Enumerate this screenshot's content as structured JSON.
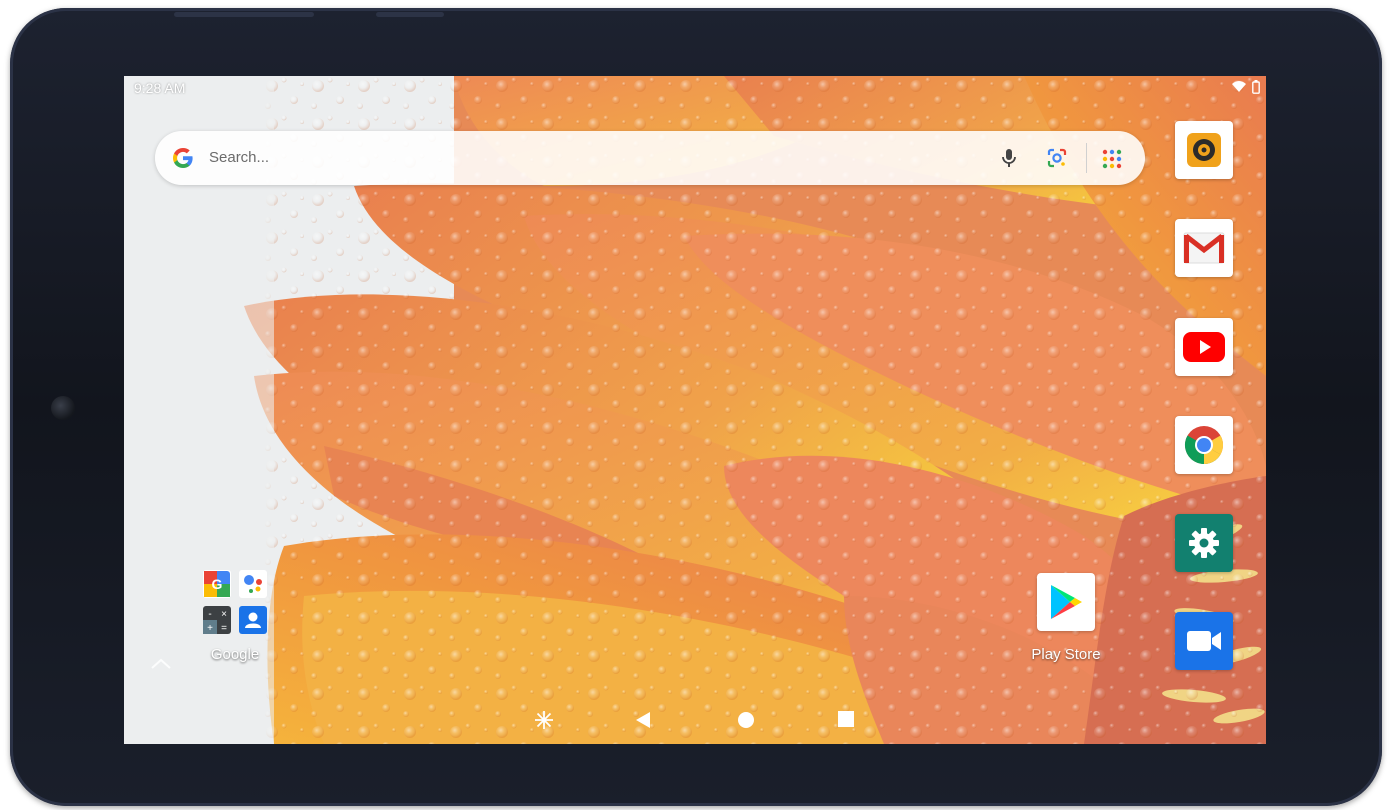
{
  "status_bar": {
    "time": "9:28 AM",
    "icons": [
      "wifi-icon",
      "battery-icon"
    ]
  },
  "search": {
    "placeholder": "Search...",
    "icons": [
      "google-g-icon",
      "microphone-icon",
      "google-lens-icon",
      "app-grid-icon"
    ]
  },
  "home": {
    "folder": {
      "label": "Google",
      "icons": [
        "google-search-icon",
        "google-assistant-icon",
        "calculator-icon",
        "contacts-icon"
      ]
    },
    "play_store": {
      "label": "Play Store"
    }
  },
  "dock": [
    "camera-app-icon",
    "gmail-icon",
    "youtube-icon",
    "chrome-icon",
    "settings-icon",
    "video-call-icon"
  ],
  "nav_bar": [
    "screenshot-icon",
    "back-icon",
    "home-icon",
    "recents-icon"
  ],
  "colors": {
    "bezel": "#171b25",
    "petal_orange": "#ec8a52",
    "petal_yellow": "#f5c23f",
    "settings_teal": "#12806f",
    "meet_blue": "#1a73e8"
  }
}
